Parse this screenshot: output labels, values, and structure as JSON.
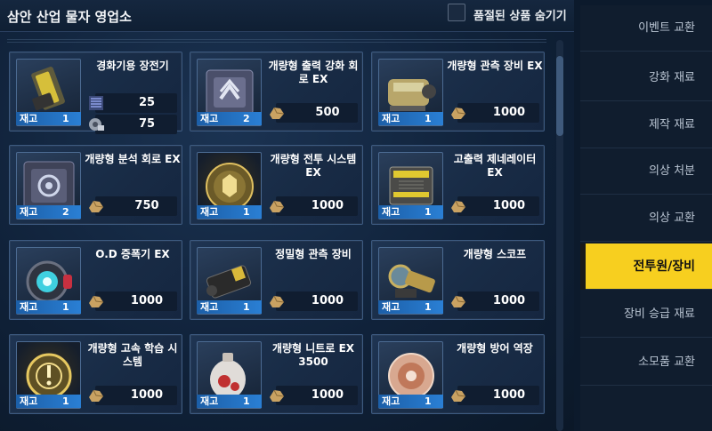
{
  "window": {
    "title": "삼안 산업 물자 영업소",
    "hide_soldout_label": "품절된 상품 숨기기"
  },
  "stock_label": "재고",
  "items": [
    {
      "name": "경화기용 장전기",
      "stock": "1",
      "prices": [
        "25",
        "75"
      ]
    },
    {
      "name": "개량형 출력 강화 회로 EX",
      "stock": "2",
      "prices": [
        "500"
      ]
    },
    {
      "name": "개량형 관측 장비 EX",
      "stock": "1",
      "prices": [
        "1000"
      ]
    },
    {
      "name": "개량형 분석 회로 EX",
      "stock": "2",
      "prices": [
        "750"
      ]
    },
    {
      "name": "개량형 전투 시스템 EX",
      "stock": "1",
      "prices": [
        "1000"
      ]
    },
    {
      "name": "고출력 제네레이터 EX",
      "stock": "1",
      "prices": [
        "1000"
      ]
    },
    {
      "name": "O.D 증폭기 EX",
      "stock": "1",
      "prices": [
        "1000"
      ]
    },
    {
      "name": "정밀형 관측 장비",
      "stock": "1",
      "prices": [
        "1000"
      ]
    },
    {
      "name": "개량형 스코프",
      "stock": "1",
      "prices": [
        "1000"
      ]
    },
    {
      "name": "개량형 고속 학습 시스템",
      "stock": "1",
      "prices": [
        "1000"
      ]
    },
    {
      "name": "개량형 니트로 EX 3500",
      "stock": "1",
      "prices": [
        "1000"
      ]
    },
    {
      "name": "개량형 방어 역장",
      "stock": "1",
      "prices": [
        "1000"
      ]
    }
  ],
  "sidebar": {
    "items": [
      {
        "label": "이벤트 교환"
      },
      {
        "label": "강화 재료"
      },
      {
        "label": "제작 재료"
      },
      {
        "label": "의상 처분"
      },
      {
        "label": "의상 교환"
      },
      {
        "label": "전투원/장비"
      },
      {
        "label": "장비 승급 재료"
      },
      {
        "label": "소모품 교환"
      }
    ],
    "active_index": 5
  },
  "colors": {
    "accent": "#f7cf1f",
    "stock_bar": "#2a7fd4",
    "card_border": "#3d5a80"
  }
}
